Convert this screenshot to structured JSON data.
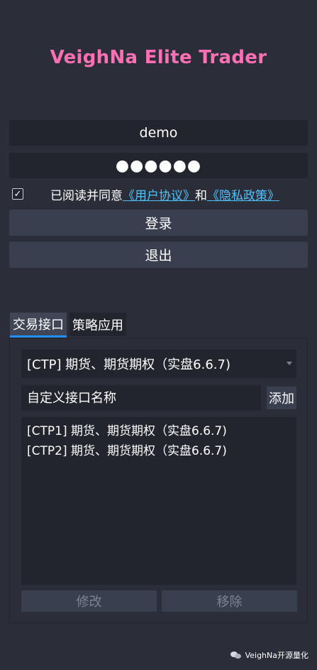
{
  "app_title": "VeighNa Elite Trader",
  "login": {
    "username_value": "demo",
    "password_value": "●●●●●●",
    "agree_checked_mark": "✓",
    "agree_prefix": "已阅读并同意",
    "user_agreement_link": "《用户协议》",
    "agree_and": "和",
    "privacy_policy_link": "《隐私政策》",
    "login_button": "登录",
    "exit_button": "退出"
  },
  "tabs": [
    {
      "label": "交易接口",
      "active": true
    },
    {
      "label": "策略应用",
      "active": false
    }
  ],
  "gateway_panel": {
    "gateway_select_value": "[CTP] 期货、期货期权（实盘6.6.7)",
    "custom_name_placeholder": "自定义接口名称",
    "add_button": "添加",
    "gateway_list": [
      "[CTP1] 期货、期货期权（实盘6.6.7)",
      "[CTP2] 期货、期货期权（实盘6.6.7)"
    ],
    "modify_button": "修改",
    "remove_button": "移除"
  },
  "watermark": "VeighNa开源量化",
  "colors": {
    "background": "#2b2e39",
    "title": "#ff6fb5",
    "link": "#4fc3ff",
    "tab_indicator": "#1e90ff"
  }
}
